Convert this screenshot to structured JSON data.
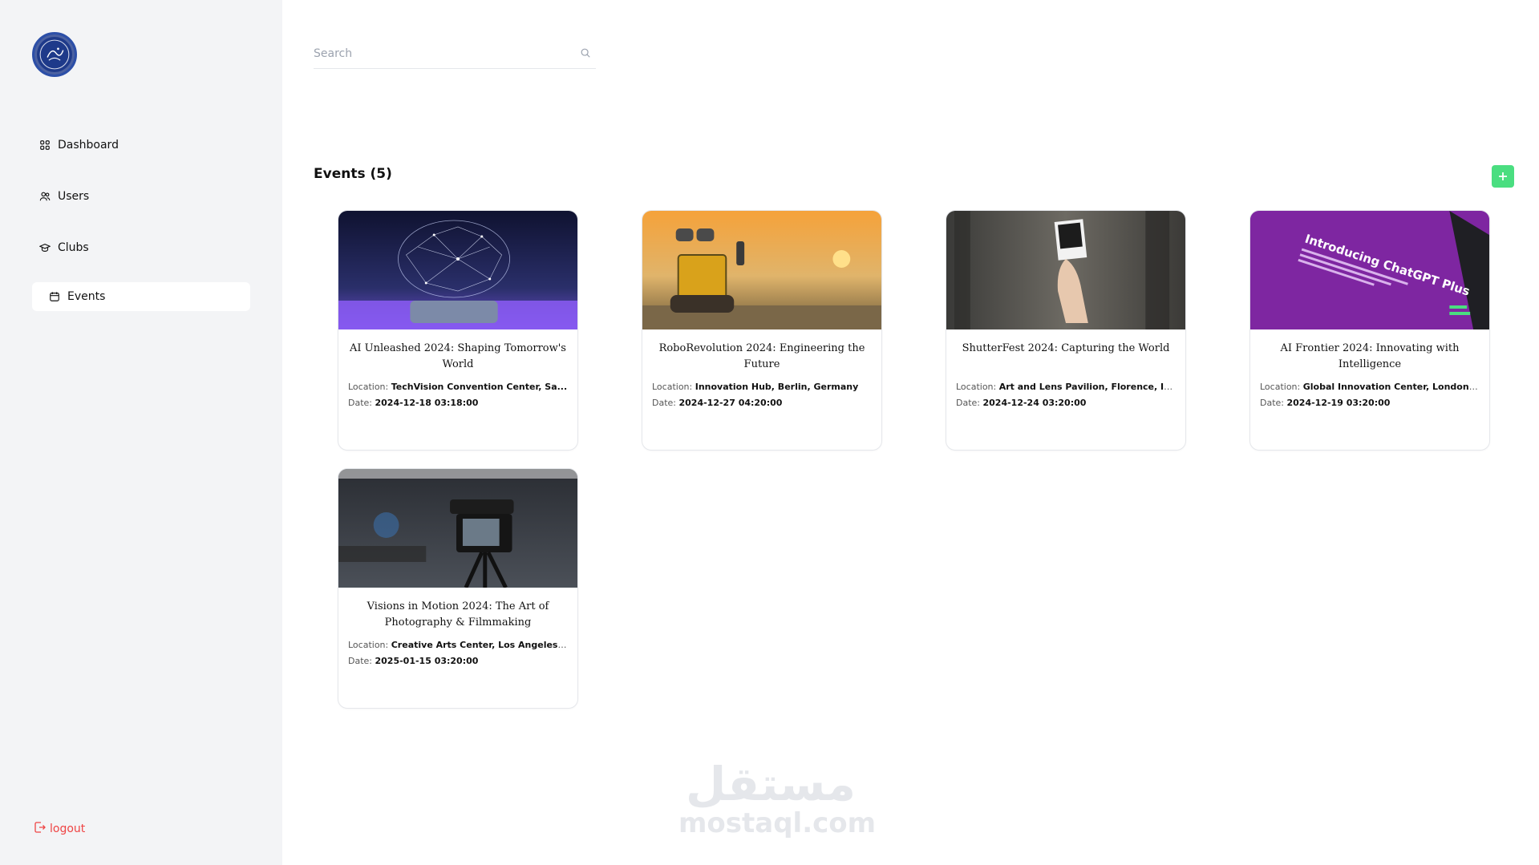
{
  "sidebar": {
    "items": [
      {
        "label": "Dashboard",
        "icon": "grid-icon"
      },
      {
        "label": "Users",
        "icon": "users-icon"
      },
      {
        "label": "Clubs",
        "icon": "graduation-cap-icon"
      },
      {
        "label": "Events",
        "icon": "calendar-icon",
        "active": true
      }
    ],
    "logout_label": "logout"
  },
  "search": {
    "placeholder": "Search",
    "value": ""
  },
  "events": {
    "heading": "Events (5)",
    "add_label": "+",
    "location_label": "Location:",
    "date_label": "Date:",
    "cards": [
      {
        "title": "AI Unleashed 2024: Shaping Tomorrow's World",
        "location": "TechVision Convention Center, Sa...",
        "date": "2024-12-18 03:18:00",
        "image": "ai-brain-image"
      },
      {
        "title": "RoboRevolution 2024: Engineering the Future",
        "location": "Innovation Hub, Berlin, Germany",
        "date": "2024-12-27 04:20:00",
        "image": "robot-sunset-image"
      },
      {
        "title": "ShutterFest 2024: Capturing the World",
        "location": "Art and Lens Pavilion, Florence, Italy",
        "date": "2024-12-24 03:20:00",
        "image": "polaroid-hand-image"
      },
      {
        "title": "AI Frontier 2024: Innovating with Intelligence",
        "location": "Global Innovation Center, London,...",
        "date": "2024-12-19 03:20:00",
        "image": "chatgpt-screen-image"
      },
      {
        "title": "Visions in Motion 2024: The Art of Photography & Filmmaking",
        "location": "Creative Arts Center, Los Angeles,...",
        "date": "2025-01-15 03:20:00",
        "image": "camera-studio-image"
      }
    ],
    "chatgpt_image_text": "Introducing ChatGPT Plus"
  },
  "watermark": {
    "arabic": "مستقل",
    "latin": "mostaql.com"
  },
  "colors": {
    "sidebar_bg": "#f3f4f6",
    "accent_green": "#4ade80",
    "logout_red": "#ef4444",
    "logo_blue": "#1e3a8a"
  }
}
